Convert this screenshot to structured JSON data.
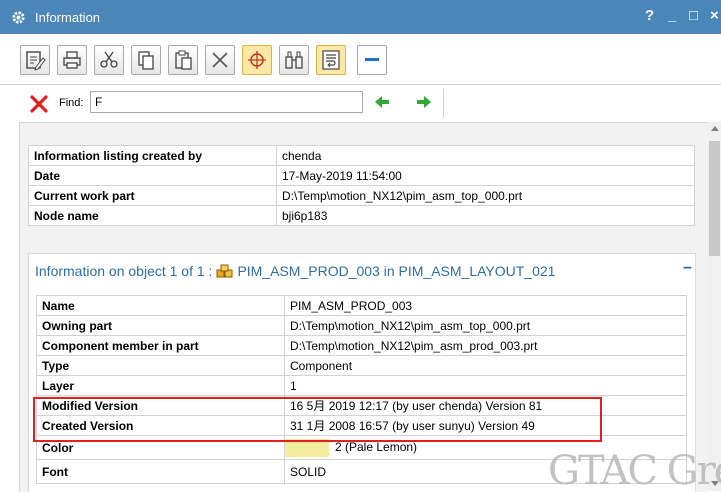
{
  "window": {
    "title": "Information",
    "controls": [
      "?",
      "_",
      "□",
      "×"
    ]
  },
  "toolbar": {
    "buttons": [
      {
        "icon": "edit-save-icon"
      },
      {
        "icon": "print-icon"
      },
      {
        "icon": "cut-icon"
      },
      {
        "icon": "copy-icon"
      },
      {
        "icon": "paste-icon"
      },
      {
        "icon": "delete-icon"
      },
      {
        "icon": "target-icon",
        "highlighted": true
      },
      {
        "icon": "binoculars-icon"
      },
      {
        "icon": "wrap-text-icon",
        "highlighted": true
      },
      {
        "icon": "minus-icon"
      }
    ]
  },
  "find": {
    "label": "Find:",
    "value": "F",
    "prev_icon": "arrow-left-icon",
    "next_icon": "arrow-right-icon"
  },
  "listing": {
    "rows": [
      {
        "key": "Information listing created by",
        "value": "chenda"
      },
      {
        "key": "Date",
        "value": "17-May-2019 11:54:00"
      },
      {
        "key": "Current work part",
        "value": "D:\\Temp\\motion_NX12\\pim_asm_top_000.prt"
      },
      {
        "key": "Node name",
        "value": "bji6p183"
      }
    ]
  },
  "object_panel": {
    "heading_prefix": "Information on object 1 of 1 :",
    "heading_object": "PIM_ASM_PROD_003 in PIM_ASM_LAYOUT_021",
    "collapse_label": "−",
    "rows": [
      {
        "key": "Name",
        "value": "PIM_ASM_PROD_003"
      },
      {
        "key": "Owning part",
        "value": "D:\\Temp\\motion_NX12\\pim_asm_top_000.prt"
      },
      {
        "key": "Component member in part",
        "value": "D:\\Temp\\motion_NX12\\pim_asm_prod_003.prt"
      },
      {
        "key": "Type",
        "value": "Component"
      },
      {
        "key": "Layer",
        "value": "1"
      },
      {
        "key": "Modified Version",
        "value": "16 5月 2019 12:17 (by user chenda) Version 81"
      },
      {
        "key": "Created Version",
        "value": "31 1月 2008 16:57 (by user sunyu) Version 49"
      },
      {
        "key": "Color",
        "value": "2 (Pale Lemon)",
        "swatch": "#f4eda0"
      },
      {
        "key": "Font",
        "value": "SOLID"
      }
    ]
  },
  "watermark": "GTAC Gre",
  "colors": {
    "titlebar": "#4a86b8",
    "heading": "#2e6da4",
    "highlight_box": "#e02020"
  }
}
